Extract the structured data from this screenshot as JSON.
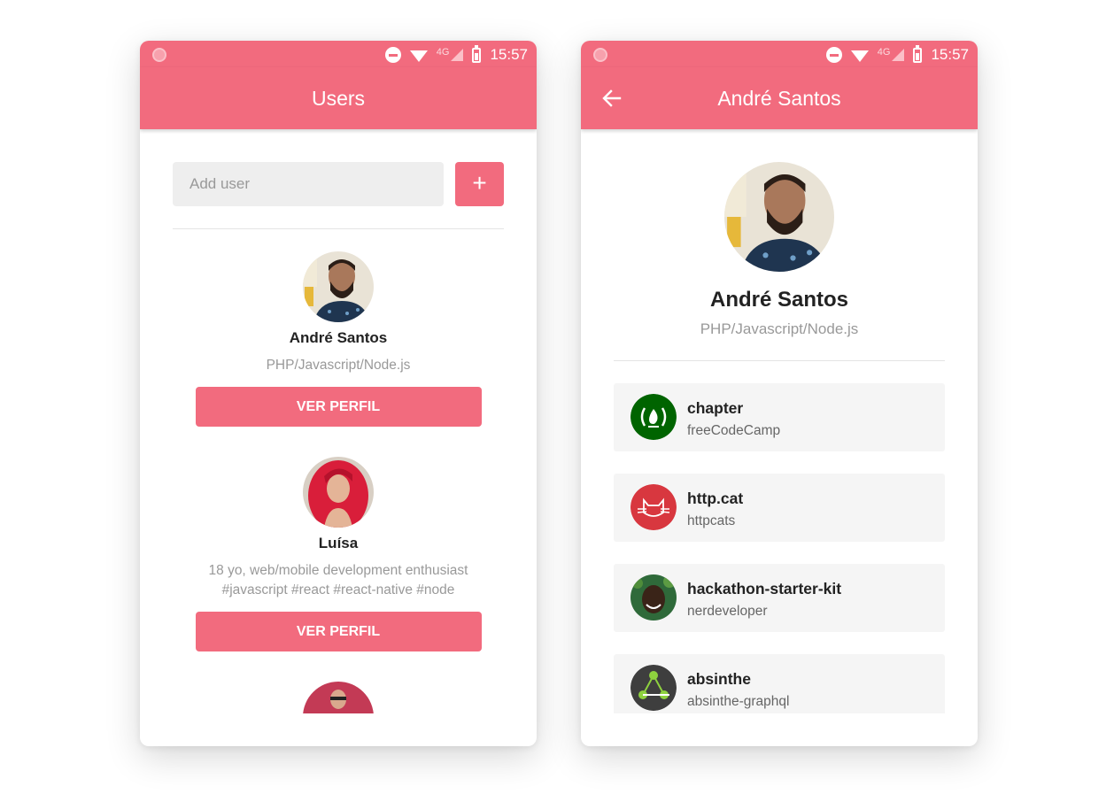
{
  "status_bar": {
    "time": "15:57",
    "network": "4G"
  },
  "users_screen": {
    "title": "Users",
    "add_input": {
      "placeholder": "Add user",
      "value": ""
    },
    "add_button_label": "+",
    "users": [
      {
        "name": "André Santos",
        "bio": "PHP/Javascript/Node.js",
        "button_label": "VER PERFIL"
      },
      {
        "name": "Luísa",
        "bio": "18 yo, web/mobile development enthusiast #javascript #react #react-native #node",
        "button_label": "VER PERFIL"
      }
    ]
  },
  "profile_screen": {
    "title": "André Santos",
    "name": "André Santos",
    "bio": "PHP/Javascript/Node.js",
    "repos": [
      {
        "name": "chapter",
        "owner": "freeCodeCamp",
        "avatar_icon": "freecodecamp-logo-icon",
        "color": "#006400"
      },
      {
        "name": "http.cat",
        "owner": "httpcats",
        "avatar_icon": "cat-logo-icon",
        "color": "#d8373f"
      },
      {
        "name": "hackathon-starter-kit",
        "owner": "nerdeveloper",
        "avatar_icon": "user-photo",
        "color": "#2f6a3a"
      },
      {
        "name": "absinthe",
        "owner": "absinthe-graphql",
        "avatar_icon": "graph-logo-icon",
        "color": "#3e3e3e"
      }
    ]
  },
  "colors": {
    "accent": "#f26b7e",
    "card_bg": "#f5f5f5",
    "input_bg": "#eeeeee"
  }
}
